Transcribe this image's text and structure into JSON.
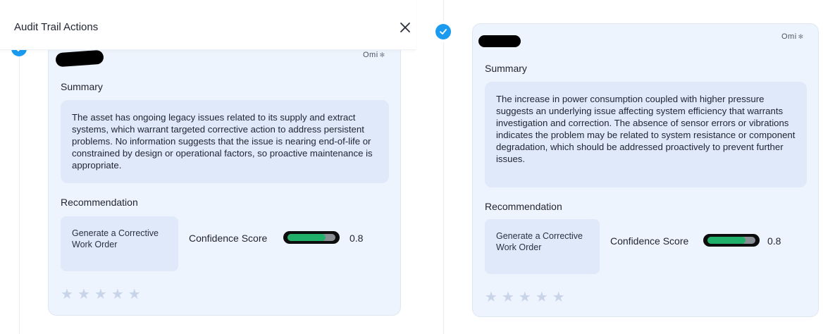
{
  "header": {
    "title": "Audit Trail Actions",
    "close_icon": "close-icon"
  },
  "cards": [
    {
      "badge": "Omi",
      "summary_label": "Summary",
      "summary_text": "The asset has ongoing legacy issues related to its supply and extract systems, which warrant targeted corrective action to address persistent problems. No information suggests that the issue is nearing end-of-life or constrained by design or operational factors, so proactive maintenance is appropriate.",
      "recommendation_label": "Recommendation",
      "recommendation_text": "Generate a Corrective Work Order",
      "confidence_label": "Confidence Score",
      "confidence_value": "0.8",
      "rating": 0,
      "rating_max": 5
    },
    {
      "badge": "Omi",
      "summary_label": "Summary",
      "summary_text": "The increase in power consumption coupled with higher pressure suggests an underlying issue affecting system efficiency that warrants investigation and correction. The absence of sensor errors or vibrations indicates the problem may be related to system resistance or component degradation, which should be addressed proactively to prevent further issues.",
      "recommendation_label": "Recommendation",
      "recommendation_text": "Generate a Corrective Work Order",
      "confidence_label": "Confidence Score",
      "confidence_value": "0.8",
      "rating": 0,
      "rating_max": 5
    }
  ],
  "colors": {
    "accent": "#1a9bef",
    "card_bg": "#eef4fd",
    "box_bg": "#dfe9fa",
    "confidence_fill": "#21b06a",
    "star_empty": "#c8d4e8"
  }
}
